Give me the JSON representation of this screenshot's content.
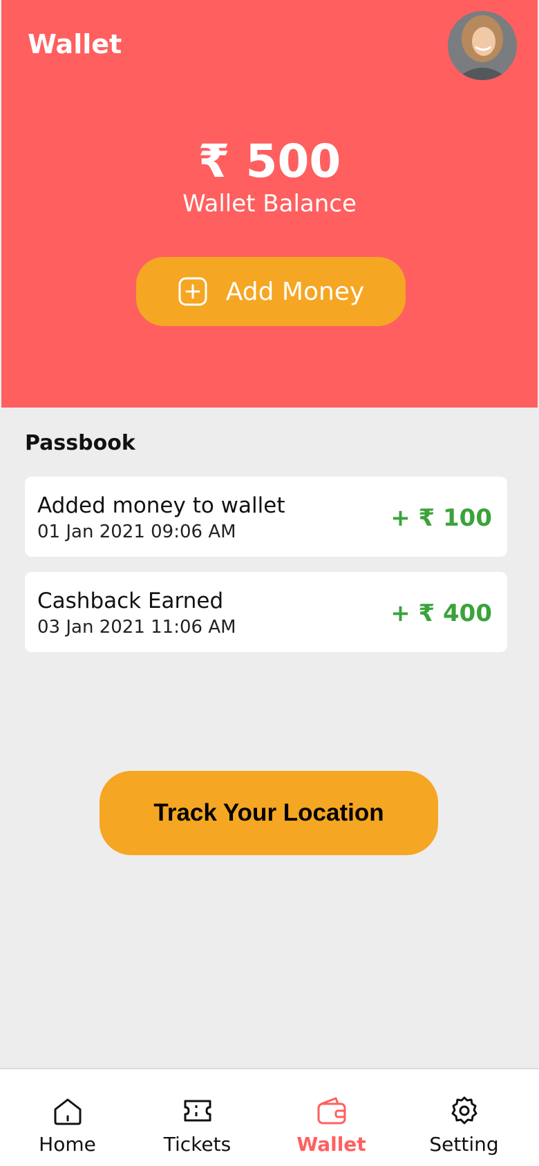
{
  "header": {
    "title": "Wallet",
    "balance": "₹ 500",
    "balance_label": "Wallet Balance",
    "add_money_label": "Add Money",
    "avatar_icon": "avatar-photo"
  },
  "passbook": {
    "title": "Passbook",
    "transactions": [
      {
        "title": "Added money to wallet",
        "date": "01 Jan 2021 09:06 AM",
        "amount": "+ ₹ 100"
      },
      {
        "title": "Cashback Earned",
        "date": "03 Jan 2021 11:06 AM",
        "amount": "+ ₹ 400"
      }
    ]
  },
  "track_button_label": "Track Your Location",
  "nav": {
    "items": [
      {
        "label": "Home",
        "icon": "home-icon"
      },
      {
        "label": "Tickets",
        "icon": "ticket-icon"
      },
      {
        "label": "Wallet",
        "icon": "wallet-icon",
        "active": true
      },
      {
        "label": "Setting",
        "icon": "gear-icon"
      }
    ]
  },
  "colors": {
    "header_bg": "#ff5f5f",
    "accent_orange": "#f5a623",
    "positive_green": "#3aa33a",
    "page_bg": "#ededed"
  }
}
